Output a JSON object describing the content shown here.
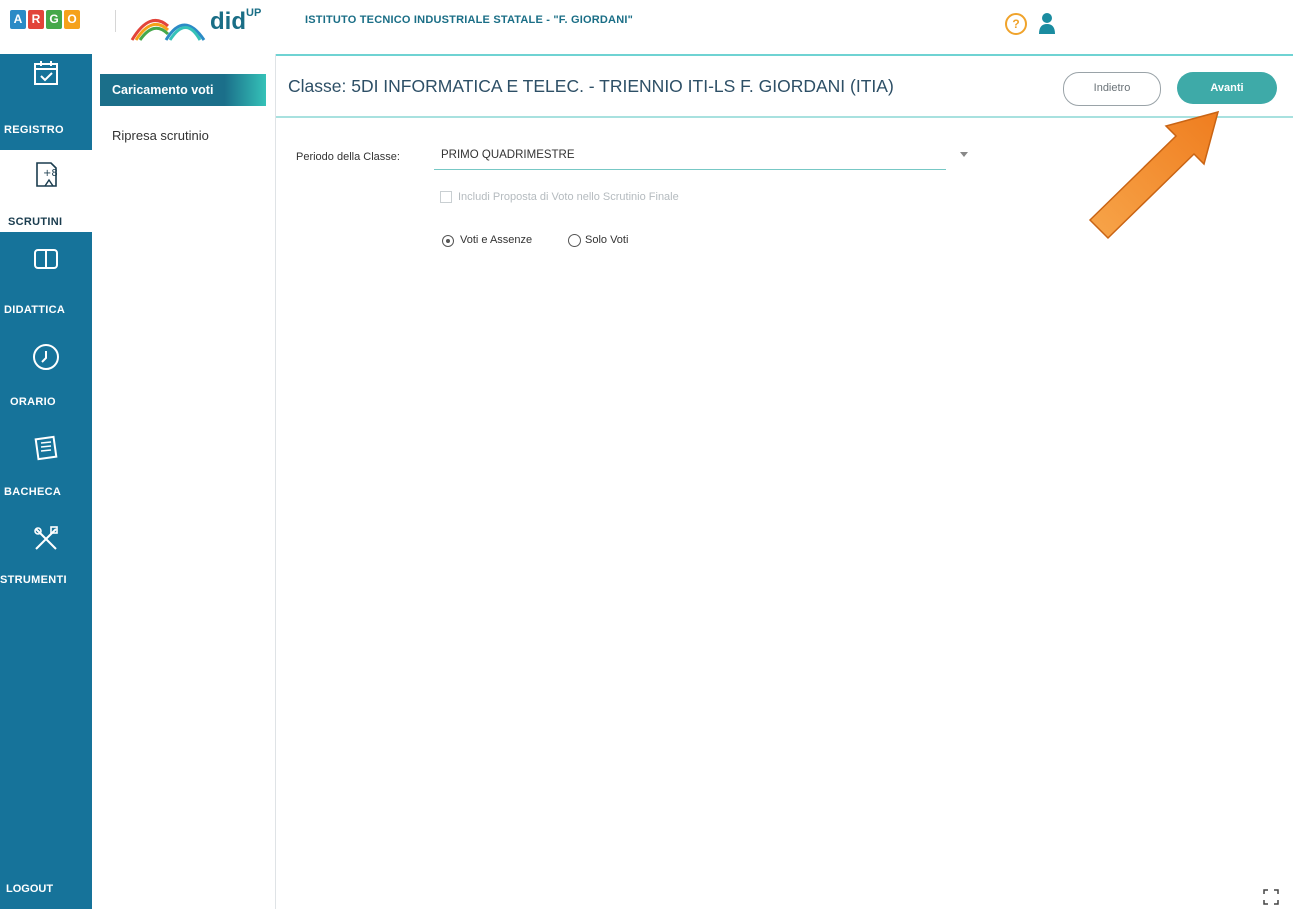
{
  "header": {
    "argo_letters": [
      "A",
      "R",
      "G",
      "O"
    ],
    "argo_colors": [
      "#2b8bc6",
      "#e2443a",
      "#45a84a",
      "#f5a11a"
    ],
    "app_name": "did",
    "app_sup": "UP",
    "school_name": "ISTITUTO TECNICO INDUSTRIALE STATALE - \"F. GIORDANI\"",
    "help_icon_glyph": "?",
    "help_icon": "help-icon",
    "user_icon": "user-icon"
  },
  "nav": {
    "items": [
      {
        "label": "REGISTRO",
        "icon": "calendar-check-icon"
      },
      {
        "label": "SCRUTINI",
        "icon": "scrutini-icon",
        "active": true
      },
      {
        "label": "DIDATTICA",
        "icon": "book-icon"
      },
      {
        "label": "ORARIO",
        "icon": "clock-icon"
      },
      {
        "label": "BACHECA",
        "icon": "notice-board-icon"
      },
      {
        "label": "STRUMENTI",
        "icon": "tools-icon"
      }
    ],
    "logout": "LOGOUT"
  },
  "subnav": {
    "active": "Caricamento voti",
    "item": "Ripresa scrutinio"
  },
  "content": {
    "class_title": "Classe: 5DI INFORMATICA E TELEC. - TRIENNIO ITI-LS F. GIORDANI (ITIA)",
    "back_button": "Indietro",
    "next_button": "Avanti",
    "periodo_label": "Periodo della Classe:",
    "periodo_value": "PRIMO QUADRIMESTRE",
    "checkbox_label": "Includi Proposta di Voto nello Scrutinio Finale",
    "checkbox_checked": false,
    "radio_options": [
      "Voti e Assenze",
      "Solo Voti"
    ],
    "radio_selected": "Voti e Assenze"
  },
  "colors": {
    "nav_bg": "#16739a",
    "accent_teal": "#3eaaa8",
    "arrow": "#f0892b"
  }
}
